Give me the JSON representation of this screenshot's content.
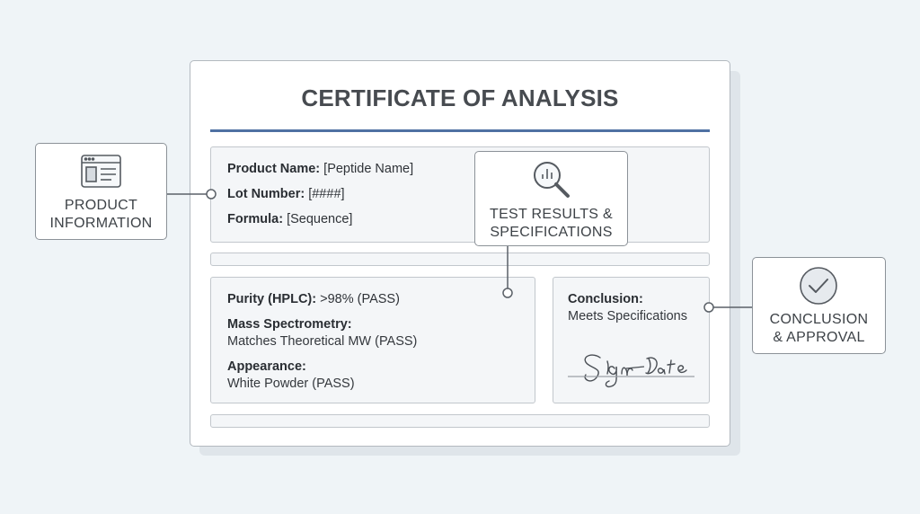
{
  "document": {
    "title": "CERTIFICATE OF ANALYSIS",
    "product_info": {
      "name_label": "Product Name:",
      "name_value": "[Peptide Name]",
      "lot_label": "Lot Number:",
      "lot_value": "[####]",
      "formula_label": "Formula:",
      "formula_value": "[Sequence]"
    },
    "tests": {
      "purity_label": "Purity (HPLC):",
      "purity_value": ">98% (PASS)",
      "mass_label": "Mass Spectrometry:",
      "mass_value": "Matches Theoretical MW (PASS)",
      "appearance_label": "Appearance:",
      "appearance_value": "White Powder (PASS)"
    },
    "conclusion": {
      "label": "Conclusion:",
      "value": "Meets Specifications",
      "signature": "Sign  Date"
    }
  },
  "callouts": {
    "product": {
      "line1": "PRODUCT",
      "line2": "INFORMATION",
      "icon": "window-icon"
    },
    "tests": {
      "line1": "TEST RESULTS &",
      "line2": "SPECIFICATIONS",
      "icon": "magnifier-chart-icon"
    },
    "conclusion": {
      "line1": "CONCLUSION",
      "line2": "& APPROVAL",
      "icon": "check-circle-icon"
    }
  },
  "colors": {
    "background": "#eff4f7",
    "accent_rule": "#4f71a3",
    "panel_fill": "#f4f6f8",
    "connector": "#5b6168"
  }
}
